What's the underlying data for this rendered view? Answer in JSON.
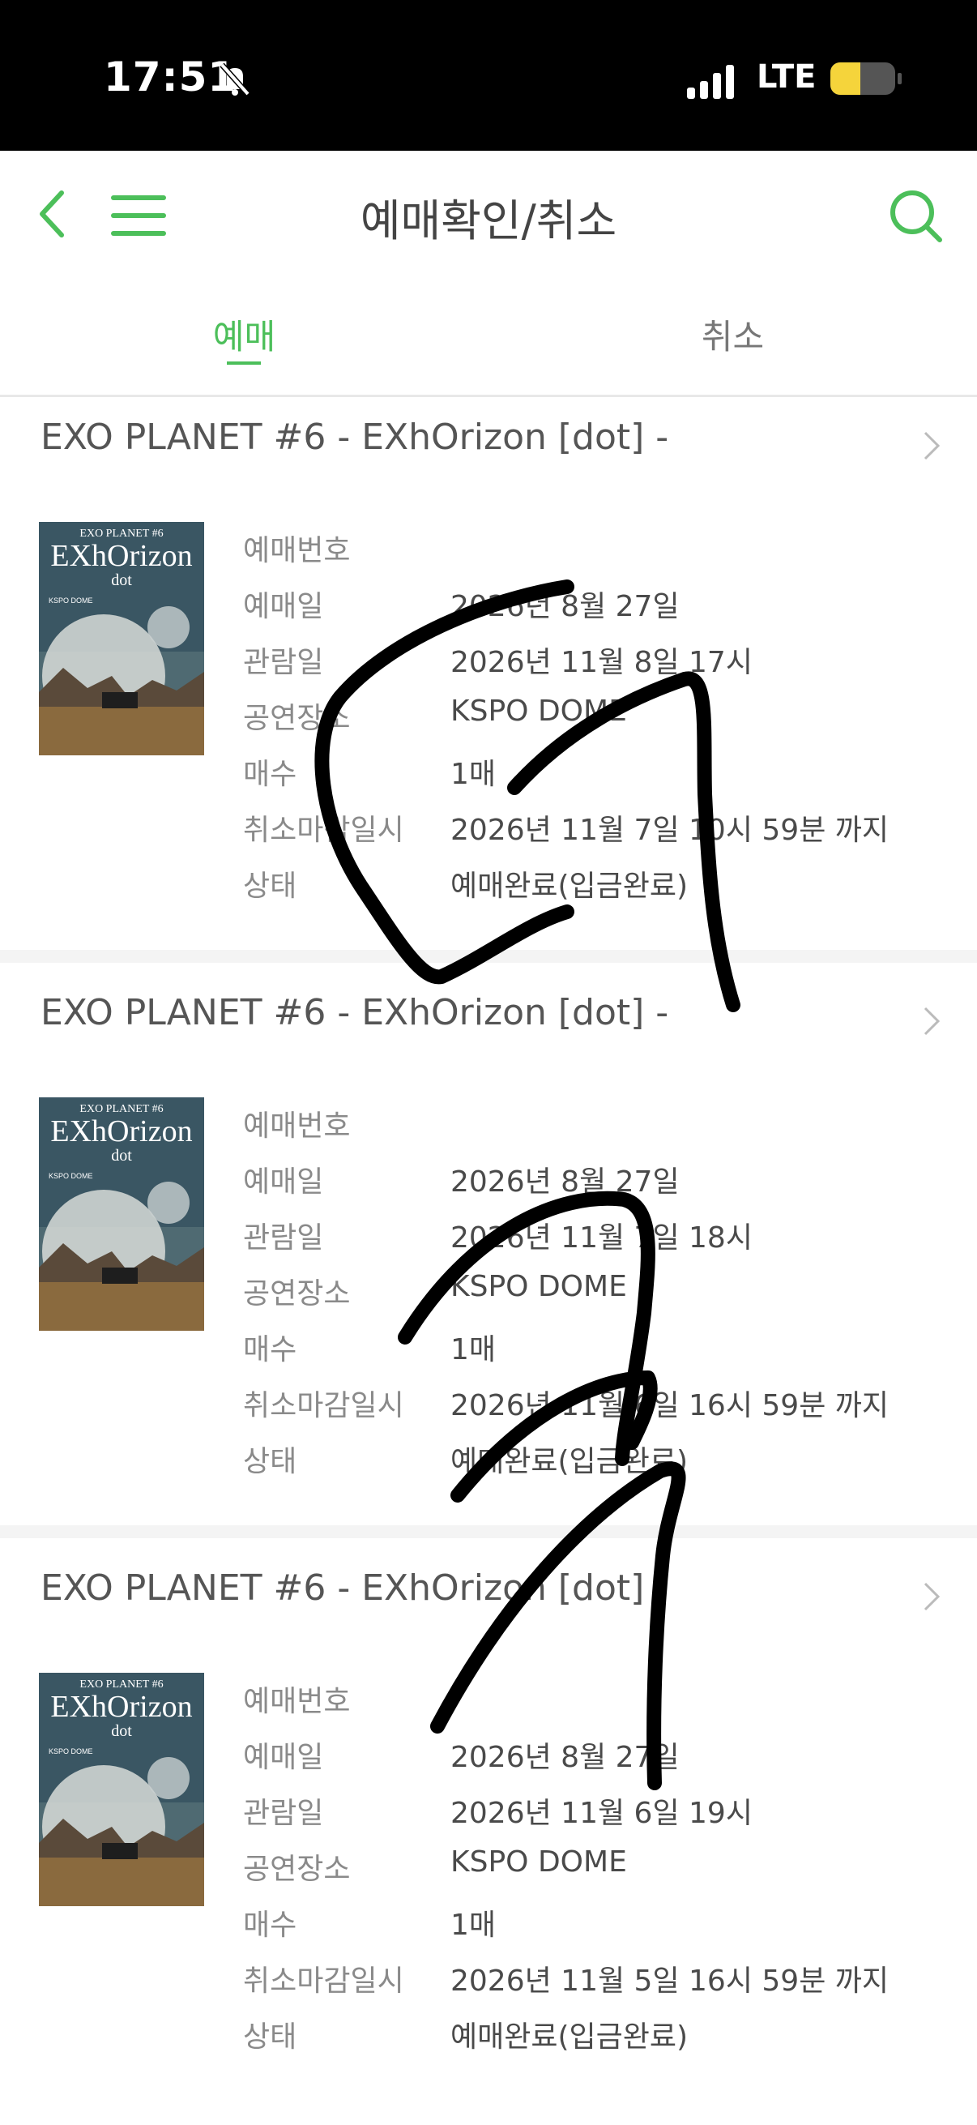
{
  "status_bar": {
    "time": "17:51",
    "network": "LTE"
  },
  "header": {
    "title": "예매확인/취소"
  },
  "tabs": [
    {
      "label": "예매",
      "active": true
    },
    {
      "label": "취소",
      "active": false
    }
  ],
  "poster": {
    "line1": "EXO PLANET #6",
    "line2": "EXhOrizon",
    "line3": "dot",
    "line4": "KSPO DOME"
  },
  "field_labels": {
    "booking_no": "예매번호",
    "booking_date": "예매일",
    "view_date": "관람일",
    "venue": "공연장소",
    "count": "매수",
    "cancel_deadline": "취소마감일시",
    "status": "상태"
  },
  "bookings": [
    {
      "title": "EXO PLANET #6 - EXhOrizon [dot] -",
      "booking_no": "",
      "booking_date": "2026년 8월 27일",
      "view_date": "2026년 11월 8일 17시",
      "venue": "KSPO DOME",
      "count": "1매",
      "cancel_deadline": "2026년 11월 7일 10시 59분 까지",
      "status": "예매완료(입금완료)"
    },
    {
      "title": "EXO PLANET #6 - EXhOrizon [dot] -",
      "booking_no": "",
      "booking_date": "2026년 8월 27일",
      "view_date": "2026년 11월 7일 18시",
      "venue": "KSPO DOME",
      "count": "1매",
      "cancel_deadline": "2026년 11월 6일 16시 59분 까지",
      "status": "예매완료(입금완료)"
    },
    {
      "title": "EXO PLANET #6 - EXhOrizon [dot] -",
      "booking_no": "",
      "booking_date": "2026년 8월 27일",
      "view_date": "2026년 11월 6일 19시",
      "venue": "KSPO DOME",
      "count": "1매",
      "cancel_deadline": "2026년 11월 5일 16시 59분 까지",
      "status": "예매완료(입금완료)"
    }
  ],
  "colors": {
    "accent": "#4cbf5a",
    "status_bar": "#000000",
    "battery": "#f5d43b"
  }
}
